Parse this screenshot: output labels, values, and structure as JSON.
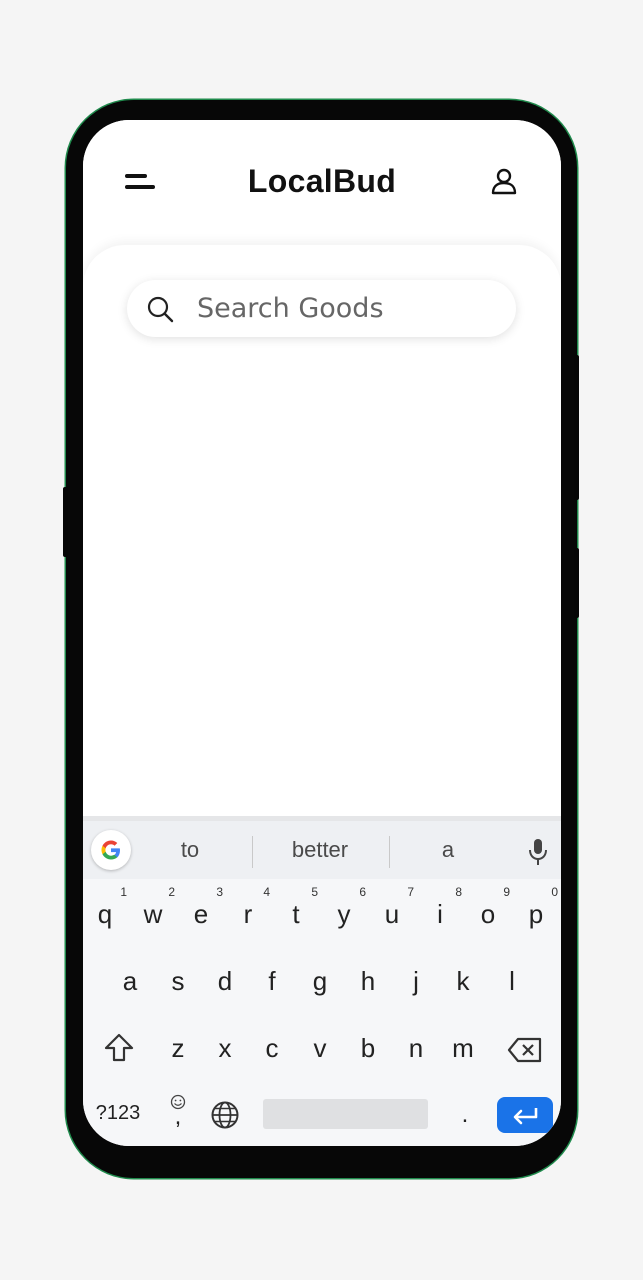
{
  "app": {
    "title": "LocalBud"
  },
  "header": {
    "menu_icon": "menu-icon",
    "profile_icon": "user-icon"
  },
  "search": {
    "placeholder": "Search Goods",
    "value": "",
    "icon": "search-icon"
  },
  "keyboard": {
    "suggestions": [
      "to",
      "better",
      "a"
    ],
    "row1": [
      {
        "key": "q",
        "num": "1"
      },
      {
        "key": "w",
        "num": "2"
      },
      {
        "key": "e",
        "num": "3"
      },
      {
        "key": "r",
        "num": "4"
      },
      {
        "key": "t",
        "num": "5"
      },
      {
        "key": "y",
        "num": "6"
      },
      {
        "key": "u",
        "num": "7"
      },
      {
        "key": "i",
        "num": "8"
      },
      {
        "key": "o",
        "num": "9"
      },
      {
        "key": "p",
        "num": "0"
      }
    ],
    "row2": [
      "a",
      "s",
      "d",
      "f",
      "g",
      "h",
      "j",
      "k",
      "l"
    ],
    "row3": [
      "z",
      "x",
      "c",
      "v",
      "b",
      "n",
      "m"
    ],
    "symbols_key": "?123",
    "comma_key": ",",
    "period_key": ".",
    "icons": [
      "google-logo-icon",
      "mic-icon",
      "shift-icon",
      "backspace-icon",
      "emoji-icon",
      "globe-icon",
      "enter-icon"
    ]
  },
  "colors": {
    "accent": "#1a73e8",
    "frame": "#070707",
    "frame_edge": "#1f8a4c"
  }
}
